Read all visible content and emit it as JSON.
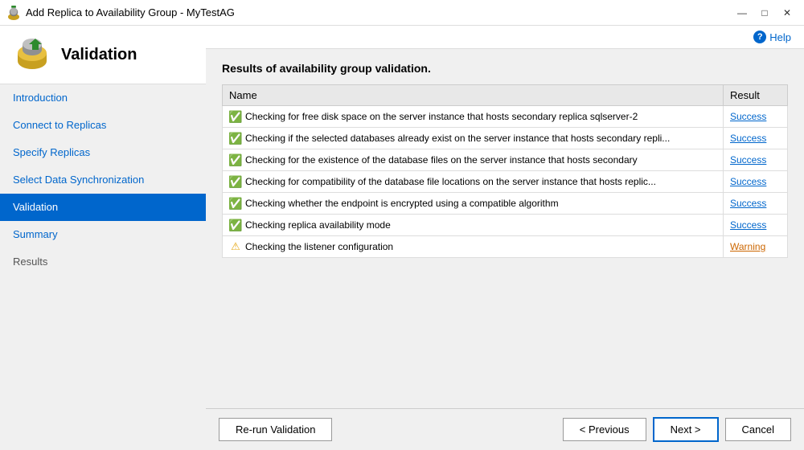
{
  "window": {
    "title": "Add Replica to Availability Group - MyTestAG"
  },
  "header": {
    "title": "Validation"
  },
  "help": {
    "label": "Help"
  },
  "nav": {
    "items": [
      {
        "id": "introduction",
        "label": "Introduction",
        "state": "link"
      },
      {
        "id": "connect-to-replicas",
        "label": "Connect to Replicas",
        "state": "link"
      },
      {
        "id": "specify-replicas",
        "label": "Specify Replicas",
        "state": "link"
      },
      {
        "id": "select-data-sync",
        "label": "Select Data Synchronization",
        "state": "link"
      },
      {
        "id": "validation",
        "label": "Validation",
        "state": "active"
      },
      {
        "id": "summary",
        "label": "Summary",
        "state": "link"
      },
      {
        "id": "results",
        "label": "Results",
        "state": "inactive"
      }
    ]
  },
  "main": {
    "results_title": "Results of availability group validation.",
    "table": {
      "col_name": "Name",
      "col_result": "Result",
      "rows": [
        {
          "icon": "success",
          "name": "Checking for free disk space on the server instance that hosts secondary replica sqlserver-2",
          "result": "Success",
          "result_type": "success"
        },
        {
          "icon": "success",
          "name": "Checking if the selected databases already exist on the server instance that hosts secondary repli...",
          "result": "Success",
          "result_type": "success"
        },
        {
          "icon": "success",
          "name": "Checking for the existence of the database files on the server instance that hosts secondary",
          "result": "Success",
          "result_type": "success"
        },
        {
          "icon": "success",
          "name": "Checking for compatibility of the database file locations on the server instance that hosts replic...",
          "result": "Success",
          "result_type": "success"
        },
        {
          "icon": "success",
          "name": "Checking whether the endpoint is encrypted using a compatible algorithm",
          "result": "Success",
          "result_type": "success"
        },
        {
          "icon": "success",
          "name": "Checking replica availability mode",
          "result": "Success",
          "result_type": "success"
        },
        {
          "icon": "warning",
          "name": "Checking the listener configuration",
          "result": "Warning",
          "result_type": "warning"
        }
      ]
    },
    "buttons": {
      "rerun": "Re-run Validation",
      "previous": "< Previous",
      "next": "Next >",
      "cancel": "Cancel"
    }
  }
}
